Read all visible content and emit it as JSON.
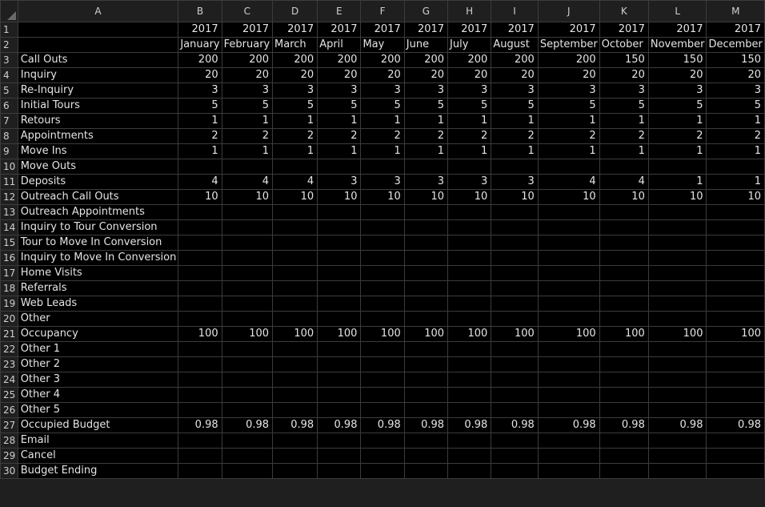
{
  "columns": [
    "A",
    "B",
    "C",
    "D",
    "E",
    "F",
    "G",
    "H",
    "I",
    "J",
    "K",
    "L",
    "M"
  ],
  "rows": [
    {
      "num": "1",
      "cells": [
        "",
        "2017",
        "2017",
        "2017",
        "2017",
        "2017",
        "2017",
        "2017",
        "2017",
        "2017",
        "2017",
        "2017",
        "2017"
      ]
    },
    {
      "num": "2",
      "cells": [
        "",
        "January",
        "February",
        "March",
        "April",
        "May",
        "June",
        "July",
        "August",
        "September",
        "October",
        "November",
        "December"
      ]
    },
    {
      "num": "3",
      "cells": [
        "Call Outs",
        "200",
        "200",
        "200",
        "200",
        "200",
        "200",
        "200",
        "200",
        "200",
        "150",
        "150",
        "150"
      ]
    },
    {
      "num": "4",
      "cells": [
        "Inquiry",
        "20",
        "20",
        "20",
        "20",
        "20",
        "20",
        "20",
        "20",
        "20",
        "20",
        "20",
        "20"
      ]
    },
    {
      "num": "5",
      "cells": [
        "Re-Inquiry",
        "3",
        "3",
        "3",
        "3",
        "3",
        "3",
        "3",
        "3",
        "3",
        "3",
        "3",
        "3"
      ]
    },
    {
      "num": "6",
      "cells": [
        "Initial Tours",
        "5",
        "5",
        "5",
        "5",
        "5",
        "5",
        "5",
        "5",
        "5",
        "5",
        "5",
        "5"
      ]
    },
    {
      "num": "7",
      "cells": [
        "Retours",
        "1",
        "1",
        "1",
        "1",
        "1",
        "1",
        "1",
        "1",
        "1",
        "1",
        "1",
        "1"
      ]
    },
    {
      "num": "8",
      "cells": [
        "Appointments",
        "2",
        "2",
        "2",
        "2",
        "2",
        "2",
        "2",
        "2",
        "2",
        "2",
        "2",
        "2"
      ]
    },
    {
      "num": "9",
      "cells": [
        "Move Ins",
        "1",
        "1",
        "1",
        "1",
        "1",
        "1",
        "1",
        "1",
        "1",
        "1",
        "1",
        "1"
      ]
    },
    {
      "num": "10",
      "cells": [
        "Move Outs",
        "",
        "",
        "",
        "",
        "",
        "",
        "",
        "",
        "",
        "",
        "",
        ""
      ]
    },
    {
      "num": "11",
      "cells": [
        "Deposits",
        "4",
        "4",
        "4",
        "3",
        "3",
        "3",
        "3",
        "3",
        "4",
        "4",
        "1",
        "1"
      ]
    },
    {
      "num": "12",
      "cells": [
        "Outreach Call Outs",
        "10",
        "10",
        "10",
        "10",
        "10",
        "10",
        "10",
        "10",
        "10",
        "10",
        "10",
        "10"
      ]
    },
    {
      "num": "13",
      "cells": [
        "Outreach Appointments",
        "",
        "",
        "",
        "",
        "",
        "",
        "",
        "",
        "",
        "",
        "",
        ""
      ]
    },
    {
      "num": "14",
      "cells": [
        "Inquiry to Tour Conversion",
        "",
        "",
        "",
        "",
        "",
        "",
        "",
        "",
        "",
        "",
        "",
        ""
      ]
    },
    {
      "num": "15",
      "cells": [
        "Tour to Move In Conversion",
        "",
        "",
        "",
        "",
        "",
        "",
        "",
        "",
        "",
        "",
        "",
        ""
      ]
    },
    {
      "num": "16",
      "cells": [
        "Inquiry to Move In Conversion",
        "",
        "",
        "",
        "",
        "",
        "",
        "",
        "",
        "",
        "",
        "",
        ""
      ]
    },
    {
      "num": "17",
      "cells": [
        "Home Visits",
        "",
        "",
        "",
        "",
        "",
        "",
        "",
        "",
        "",
        "",
        "",
        ""
      ]
    },
    {
      "num": "18",
      "cells": [
        "Referrals",
        "",
        "",
        "",
        "",
        "",
        "",
        "",
        "",
        "",
        "",
        "",
        ""
      ]
    },
    {
      "num": "19",
      "cells": [
        "Web Leads",
        "",
        "",
        "",
        "",
        "",
        "",
        "",
        "",
        "",
        "",
        "",
        ""
      ]
    },
    {
      "num": "20",
      "cells": [
        "Other",
        "",
        "",
        "",
        "",
        "",
        "",
        "",
        "",
        "",
        "",
        "",
        ""
      ]
    },
    {
      "num": "21",
      "cells": [
        "Occupancy",
        "100",
        "100",
        "100",
        "100",
        "100",
        "100",
        "100",
        "100",
        "100",
        "100",
        "100",
        "100"
      ]
    },
    {
      "num": "22",
      "cells": [
        "Other 1",
        "",
        "",
        "",
        "",
        "",
        "",
        "",
        "",
        "",
        "",
        "",
        ""
      ]
    },
    {
      "num": "23",
      "cells": [
        "Other 2",
        "",
        "",
        "",
        "",
        "",
        "",
        "",
        "",
        "",
        "",
        "",
        ""
      ]
    },
    {
      "num": "24",
      "cells": [
        "Other 3",
        "",
        "",
        "",
        "",
        "",
        "",
        "",
        "",
        "",
        "",
        "",
        ""
      ]
    },
    {
      "num": "25",
      "cells": [
        "Other 4",
        "",
        "",
        "",
        "",
        "",
        "",
        "",
        "",
        "",
        "",
        "",
        ""
      ]
    },
    {
      "num": "26",
      "cells": [
        "Other 5",
        "",
        "",
        "",
        "",
        "",
        "",
        "",
        "",
        "",
        "",
        "",
        ""
      ]
    },
    {
      "num": "27",
      "cells": [
        "Occupied Budget",
        "0.98",
        "0.98",
        "0.98",
        "0.98",
        "0.98",
        "0.98",
        "0.98",
        "0.98",
        "0.98",
        "0.98",
        "0.98",
        "0.98"
      ]
    },
    {
      "num": "28",
      "cells": [
        "Email",
        "",
        "",
        "",
        "",
        "",
        "",
        "",
        "",
        "",
        "",
        "",
        ""
      ]
    },
    {
      "num": "29",
      "cells": [
        "Cancel",
        "",
        "",
        "",
        "",
        "",
        "",
        "",
        "",
        "",
        "",
        "",
        ""
      ]
    },
    {
      "num": "30",
      "cells": [
        "Budget Ending",
        "",
        "",
        "",
        "",
        "",
        "",
        "",
        "",
        "",
        "",
        "",
        ""
      ]
    }
  ]
}
